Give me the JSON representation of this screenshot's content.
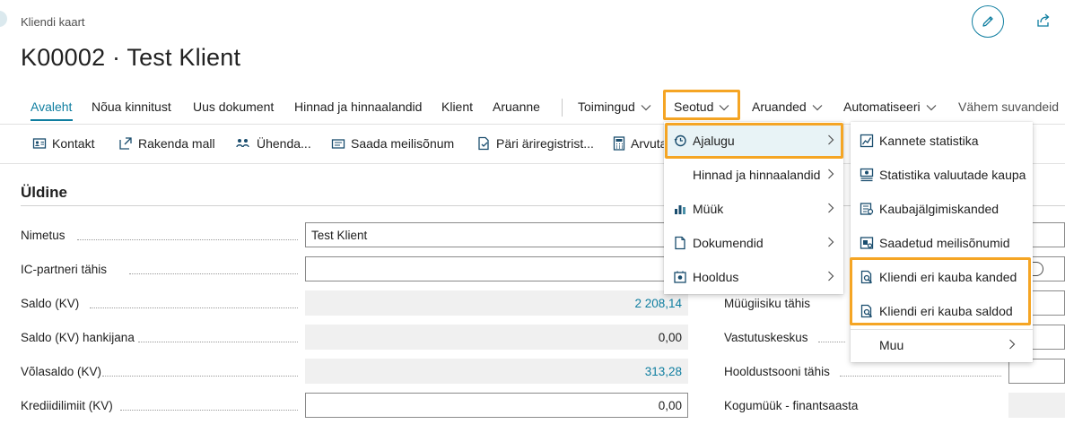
{
  "header": {
    "breadcrumb": "Kliendi kaart",
    "title": "K00002 · Test Klient"
  },
  "actionbar": {
    "items": [
      {
        "label": "Avaleht"
      },
      {
        "label": "Nõua kinnitust"
      },
      {
        "label": "Uus dokument"
      },
      {
        "label": "Hinnad ja hinnaalandid"
      },
      {
        "label": "Klient"
      },
      {
        "label": "Aruanne"
      },
      {
        "label": "Toimingud"
      },
      {
        "label": "Seotud"
      },
      {
        "label": "Aruanded"
      },
      {
        "label": "Automatiseeri"
      },
      {
        "label": "Vähem suvandeid"
      }
    ]
  },
  "toolbar": {
    "items": [
      {
        "label": "Kontakt"
      },
      {
        "label": "Rakenda mall"
      },
      {
        "label": "Ühenda..."
      },
      {
        "label": "Saada meilisõnum"
      },
      {
        "label": "Päri äriregistrist..."
      },
      {
        "label": "Arvuta"
      }
    ]
  },
  "section": {
    "title": "Üldine",
    "fields": [
      {
        "label": "Nimetus",
        "value": "Test Klient"
      },
      {
        "label": "IC-partneri tähis",
        "value": ""
      },
      {
        "label": "Saldo (KV)",
        "value": "2 208,14"
      },
      {
        "label": "Saldo (KV) hankijana",
        "value": "0,00"
      },
      {
        "label": "Võlasaldo (KV)",
        "value": "313,28"
      },
      {
        "label": "Krediidilimiit (KV)",
        "value": "0,00"
      }
    ],
    "right_fields": [
      {
        "label": "Müügiisiku tähis"
      },
      {
        "label": "Vastutuskeskus"
      },
      {
        "label": "Hooldustsooni tähis"
      },
      {
        "label": "Kogumüük - finantsaasta"
      }
    ]
  },
  "menu_seotud": {
    "items": [
      {
        "label": "Ajalugu",
        "icon": "history-icon"
      },
      {
        "label": "Hinnad ja hinnaalandid",
        "icon": ""
      },
      {
        "label": "Müük",
        "icon": "sales-icon"
      },
      {
        "label": "Dokumendid",
        "icon": "document-icon"
      },
      {
        "label": "Hooldus",
        "icon": "service-icon"
      }
    ]
  },
  "menu_ajalugu": {
    "items": [
      {
        "label": "Kannete statistika",
        "icon": "statistics-icon"
      },
      {
        "label": "Statistika valuutade kaupa",
        "icon": "currency-statistics-icon"
      },
      {
        "label": "Kaubajälgimiskanded",
        "icon": "item-tracing-icon"
      },
      {
        "label": "Saadetud meilisõnumid",
        "icon": "sent-emails-icon"
      },
      {
        "label": "Kliendi eri kauba kanded",
        "icon": "search-document-icon"
      },
      {
        "label": "Kliendi eri kauba saldod",
        "icon": "search-document-icon"
      },
      {
        "label": "Muu",
        "icon": ""
      }
    ]
  },
  "colors": {
    "accent": "#0f7ea0",
    "highlight": "#f5a524"
  }
}
